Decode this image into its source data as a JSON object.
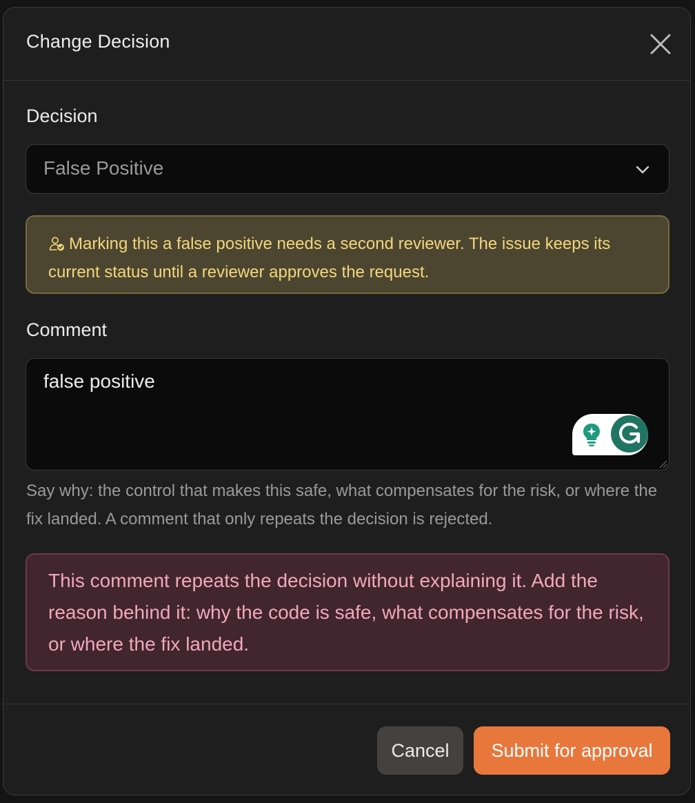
{
  "dialog": {
    "title": "Change Decision",
    "close_icon": "close-icon"
  },
  "decision": {
    "label": "Decision",
    "selected": "False Positive",
    "dropdown_icon": "chevron-down-icon"
  },
  "notice": {
    "icon": "user-check-icon",
    "text": "Marking this a false positive needs a second reviewer. The issue keeps its current status until a reviewer approves the request.",
    "color": "#f3d77c"
  },
  "comment": {
    "label": "Comment",
    "value": "false positive",
    "helper": "Say why: the control that makes this safe, what compensates for the risk, or where the fix landed. A comment that only repeats the decision is rejected.",
    "extension_icons": [
      "lightbulb-icon",
      "grammarly-icon"
    ]
  },
  "error": {
    "text": "This comment repeats the decision without explaining it. Add the reason behind it: why the code is safe, what compensates for the risk, or where the fix landed.",
    "color": "#f2a8bd"
  },
  "footer": {
    "cancel_label": "Cancel",
    "submit_label": "Submit for approval",
    "submit_color": "#e8773c"
  }
}
